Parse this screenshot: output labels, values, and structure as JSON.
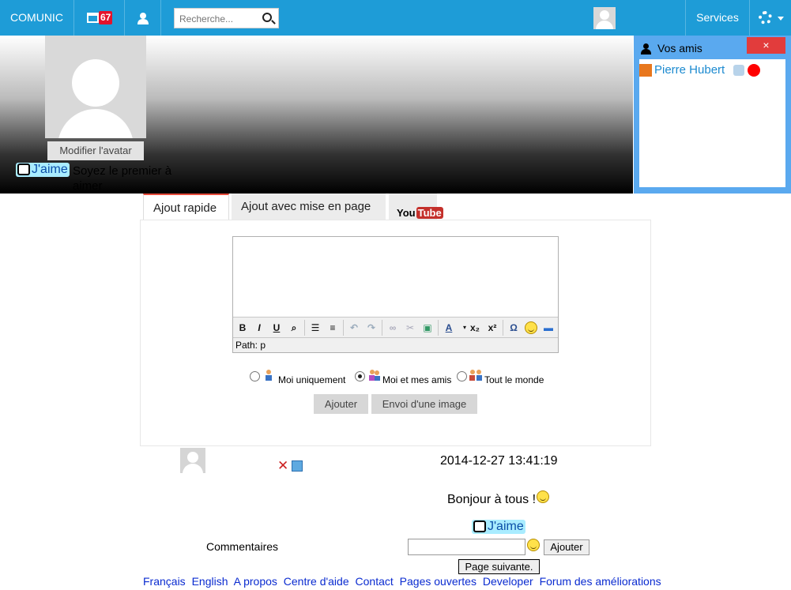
{
  "topbar": {
    "brand": "COMUNIC",
    "notification_count": "67",
    "search_placeholder": "Recherche...",
    "services_label": "Services"
  },
  "profile": {
    "modify_avatar_label": "Modifier l'avatar",
    "like_label": "J'aime",
    "be_first_text": "Soyez le premier à aimer"
  },
  "friends_panel": {
    "title": "Vos amis",
    "close_label": "×",
    "friends": [
      {
        "name": "Pierre Hubert",
        "status_color": "#ff0000"
      }
    ]
  },
  "composer": {
    "tabs": [
      {
        "label": "Ajout rapide",
        "active": true
      },
      {
        "label": "Ajout avec mise en page",
        "active": false
      },
      {
        "label": "YouTube",
        "active": false
      }
    ],
    "youtube_you": "You",
    "youtube_tube": "Tube",
    "editor_path": "Path: p",
    "visibility_options": [
      {
        "label": "Moi uniquement",
        "selected": false
      },
      {
        "label": "Moi et mes amis",
        "selected": true
      },
      {
        "label": "Tout le monde",
        "selected": false
      }
    ],
    "add_button": "Ajouter",
    "send_image_button": "Envoi d'une image"
  },
  "post": {
    "date": "2014-12-27 13:41:19",
    "message": "Bonjour à tous !",
    "like_label": "J'aime",
    "comments_label": "Commentaires",
    "comment_submit": "Ajouter",
    "next_page": "Page suivante."
  },
  "footer": {
    "links": [
      "Français",
      "English",
      "A propos",
      "Centre d'aide",
      "Contact",
      "Pages ouvertes",
      "Developer",
      "Forum des améliorations"
    ]
  },
  "colors": {
    "topbar": "#1e9cd7",
    "like_bg": "#a9ecff",
    "friends_bg": "#5aa9ef",
    "close_bg": "#e23c3c",
    "badge": "#e4132c"
  }
}
